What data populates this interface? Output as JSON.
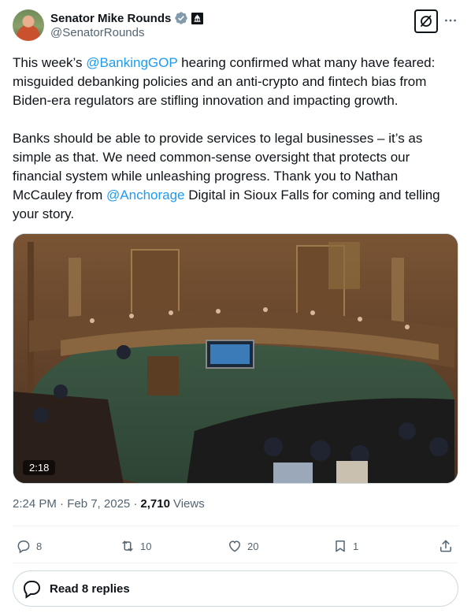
{
  "author": {
    "display_name": "Senator Mike Rounds",
    "handle": "@SenatorRounds",
    "verified_icon": "gray-verified-badge-icon",
    "affiliation_icon": "capitol-building-icon"
  },
  "tweet": {
    "p1_pre": "This week’s ",
    "p1_mention": "@BankingGOP",
    "p1_post": " hearing confirmed what many have feared: misguided debanking policies and an anti-crypto and fintech bias from Biden-era regulators are stifling innovation and impacting growth.",
    "p2_pre": "Banks should be able to provide services to legal businesses – it’s as simple as that. We need common-sense oversight that protects our financial system while unleashing progress. Thank you to Nathan McCauley from ",
    "p2_mention": "@Anchorage",
    "p2_post": " Digital in Sioux Falls for coming and telling your story."
  },
  "media": {
    "duration": "2:18"
  },
  "meta": {
    "timestamp": "2:24 PM · Feb 7, 2025 · ",
    "views_count": "2,710",
    "views_label": "Views"
  },
  "actions": {
    "replies": "8",
    "reposts": "10",
    "likes": "20",
    "bookmarks": "1"
  },
  "read_replies": {
    "label": "Read 8 replies"
  },
  "colors": {
    "accent": "#1d9bf0",
    "text": "#0f1419",
    "secondary": "#536471",
    "border": "#cfd9de"
  }
}
